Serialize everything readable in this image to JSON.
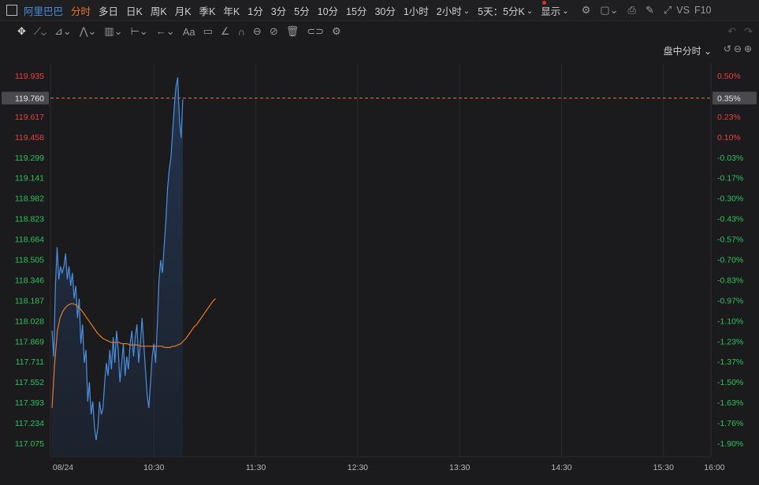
{
  "toolbar": {
    "stock": "阿里巴巴",
    "timeframes": [
      "分时",
      "多日",
      "日K",
      "周K",
      "月K",
      "季K",
      "年K",
      "1分",
      "3分",
      "5分",
      "10分",
      "15分",
      "30分",
      "1小时"
    ],
    "two_hour": "2小时",
    "five_day": "5天：5分K",
    "display": "显示",
    "vs": "VS",
    "f10": "F10"
  },
  "chart_mode": "盘中分时",
  "colors": {
    "price_line": "#4a8fe0",
    "avg_line": "#e8782a",
    "up": "#e84040",
    "down": "#2fc25b"
  },
  "chart_data": {
    "type": "line",
    "current_price_label": "119.760",
    "current_pct_label": "0.35%",
    "current_price": 119.76,
    "y_ticks": [
      "119.935",
      "119.760",
      "119.617",
      "119.458",
      "119.299",
      "119.141",
      "118.982",
      "118.823",
      "118.664",
      "118.505",
      "118.346",
      "118.187",
      "118.028",
      "117.869",
      "117.711",
      "117.552",
      "117.393",
      "117.234",
      "117.075"
    ],
    "pct_ticks": [
      "0.50%",
      "0.35%",
      "0.23%",
      "0.10%",
      "-0.03%",
      "-0.17%",
      "-0.30%",
      "-0.43%",
      "-0.57%",
      "-0.70%",
      "-0.83%",
      "-0.97%",
      "-1.10%",
      "-1.23%",
      "-1.37%",
      "-1.50%",
      "-1.63%",
      "-1.76%",
      "-1.90%"
    ],
    "x_ticks": [
      "08/24",
      "10:30",
      "11:30",
      "12:30",
      "13:30",
      "14:30",
      "15:30",
      "16:00"
    ],
    "ylim": [
      117.075,
      119.935
    ],
    "x_minutes": [
      0,
      1,
      2,
      3,
      4,
      5,
      6,
      7,
      8,
      9,
      10,
      11,
      12,
      13,
      14,
      15,
      16,
      17,
      18,
      19,
      20,
      21,
      22,
      23,
      24,
      25,
      26,
      27,
      28,
      29,
      30,
      31,
      32,
      33,
      34,
      35,
      36,
      37,
      38,
      39,
      40,
      41,
      42,
      43,
      44,
      45,
      46,
      47,
      48,
      49,
      50,
      51,
      52,
      53,
      54,
      55,
      56,
      57,
      58,
      59,
      60,
      61,
      62,
      63,
      64,
      65,
      66,
      67,
      68,
      69,
      70,
      71,
      72,
      73,
      74,
      75,
      76,
      77
    ],
    "price": [
      117.95,
      117.75,
      118.3,
      118.6,
      118.35,
      118.45,
      118.4,
      118.45,
      118.55,
      118.35,
      118.45,
      118.3,
      118.4,
      118.2,
      118.3,
      118.05,
      118.2,
      117.85,
      118.0,
      117.7,
      117.8,
      117.4,
      117.55,
      117.3,
      117.4,
      117.2,
      117.1,
      117.2,
      117.4,
      117.3,
      117.35,
      117.55,
      117.7,
      117.6,
      117.8,
      117.65,
      117.9,
      117.7,
      117.95,
      117.8,
      117.55,
      117.7,
      117.85,
      117.6,
      117.75,
      117.65,
      117.85,
      117.95,
      117.75,
      117.9,
      118.0,
      117.7,
      117.85,
      118.05,
      117.85,
      117.65,
      117.45,
      117.35,
      117.55,
      117.75,
      117.85,
      117.7,
      118.0,
      118.35,
      118.5,
      118.4,
      118.6,
      118.8,
      119.05,
      119.2,
      119.3,
      119.5,
      119.7,
      119.85,
      119.92,
      119.6,
      119.45,
      119.75
    ],
    "average": [
      117.35,
      117.7,
      117.95,
      118.05,
      118.1,
      118.13,
      118.15,
      118.16,
      118.16,
      118.15,
      118.13,
      118.11,
      118.08,
      118.05,
      118.02,
      117.99,
      117.96,
      117.93,
      117.91,
      117.89,
      117.88,
      117.87,
      117.86,
      117.86,
      117.86,
      117.86,
      117.85,
      117.85,
      117.85,
      117.84,
      117.84,
      117.84,
      117.84,
      117.83,
      117.83,
      117.83,
      117.83,
      117.83,
      117.83,
      117.83,
      117.83,
      117.83,
      117.82,
      117.82,
      117.82,
      117.83,
      117.83,
      117.84,
      117.85,
      117.87,
      117.89,
      117.92,
      117.95,
      117.98,
      118.0,
      118.03,
      118.06,
      118.09,
      118.12,
      118.15,
      118.18,
      118.2
    ]
  }
}
